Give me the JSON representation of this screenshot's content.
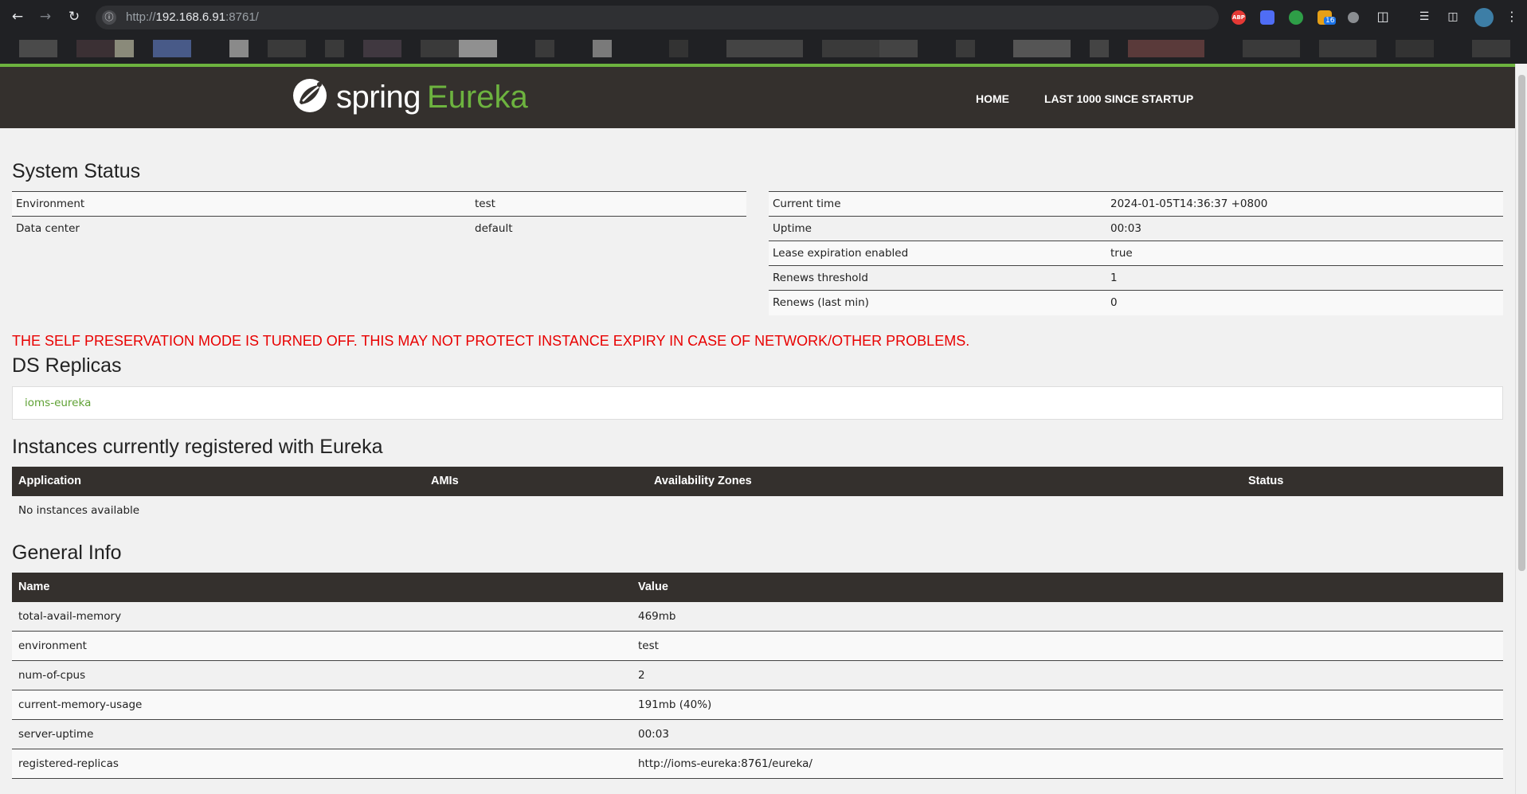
{
  "browser": {
    "url_prefix": "http://",
    "url_host": "192.168.6.91",
    "url_suffix": ":8761/",
    "ext_badge": "16",
    "ext_abp_label": "ABP"
  },
  "header": {
    "logo_spring": "spring",
    "logo_eureka": "Eureka",
    "nav_home": "HOME",
    "nav_last1000": "LAST 1000 SINCE STARTUP"
  },
  "system_status": {
    "title": "System Status",
    "left": [
      {
        "label": "Environment",
        "value": "test"
      },
      {
        "label": "Data center",
        "value": "default"
      }
    ],
    "right": [
      {
        "label": "Current time",
        "value": "2024-01-05T14:36:37 +0800"
      },
      {
        "label": "Uptime",
        "value": "00:03"
      },
      {
        "label": "Lease expiration enabled",
        "value": "true"
      },
      {
        "label": "Renews threshold",
        "value": "1"
      },
      {
        "label": "Renews (last min)",
        "value": "0"
      }
    ]
  },
  "warning": "THE SELF PRESERVATION MODE IS TURNED OFF. THIS MAY NOT PROTECT INSTANCE EXPIRY IN CASE OF NETWORK/OTHER PROBLEMS.",
  "replicas": {
    "title": "DS Replicas",
    "item": "ioms-eureka"
  },
  "instances": {
    "title": "Instances currently registered with Eureka",
    "headers": [
      "Application",
      "AMIs",
      "Availability Zones",
      "Status"
    ],
    "empty": "No instances available"
  },
  "general_info": {
    "title": "General Info",
    "headers": [
      "Name",
      "Value"
    ],
    "rows": [
      {
        "name": "total-avail-memory",
        "value": "469mb"
      },
      {
        "name": "environment",
        "value": "test"
      },
      {
        "name": "num-of-cpus",
        "value": "2"
      },
      {
        "name": "current-memory-usage",
        "value": "191mb (40%)"
      },
      {
        "name": "server-uptime",
        "value": "00:03"
      },
      {
        "name": "registered-replicas",
        "value": "http://ioms-eureka:8761/eureka/"
      }
    ]
  },
  "colors": {
    "brand_green": "#6db33f",
    "navbar_bg": "#34302d",
    "warning_red": "#e80000"
  }
}
